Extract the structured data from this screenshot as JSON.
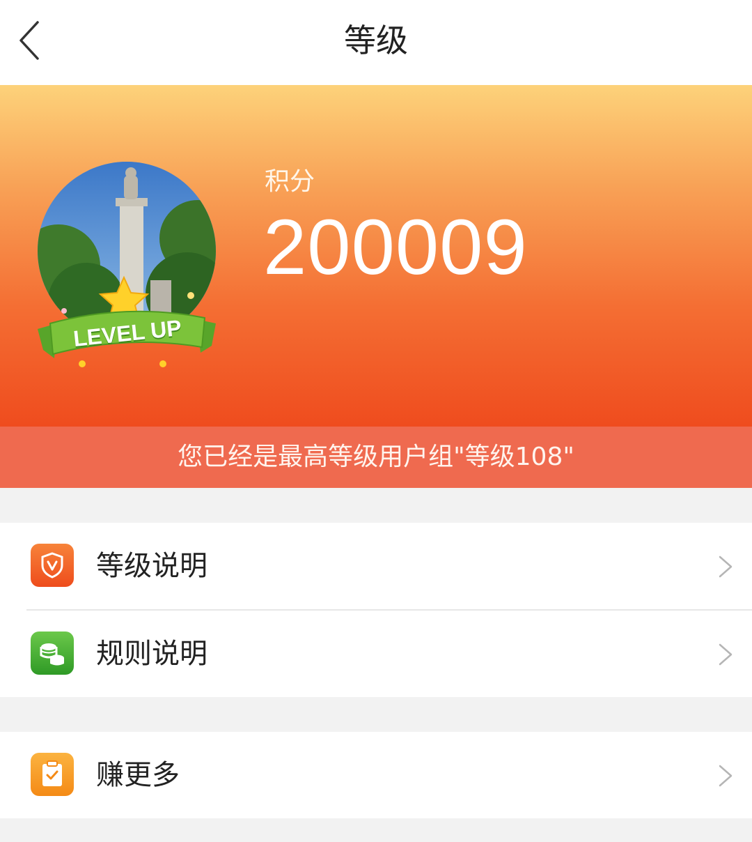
{
  "header": {
    "title": "等级",
    "back_icon": "chevron-left-icon"
  },
  "profile": {
    "badge_text": "LEVEL UP",
    "score_label": "积分",
    "score_value": "200009",
    "notice": "您已经是最高等级用户组\"等级108\""
  },
  "menu": {
    "group1": [
      {
        "label": "等级说明",
        "icon": "shield-v-icon",
        "color": "#f05a24"
      },
      {
        "label": "规则说明",
        "icon": "coins-icon",
        "color": "#3fae34"
      }
    ],
    "group2": [
      {
        "label": "赚更多",
        "icon": "clipboard-check-icon",
        "color": "#f6921e"
      }
    ]
  },
  "colors": {
    "hero_top": "#fdd27a",
    "hero_bottom": "#ef4c1e",
    "notice_bg": "#ef6a4f",
    "badge_green": "#7cc33a"
  }
}
